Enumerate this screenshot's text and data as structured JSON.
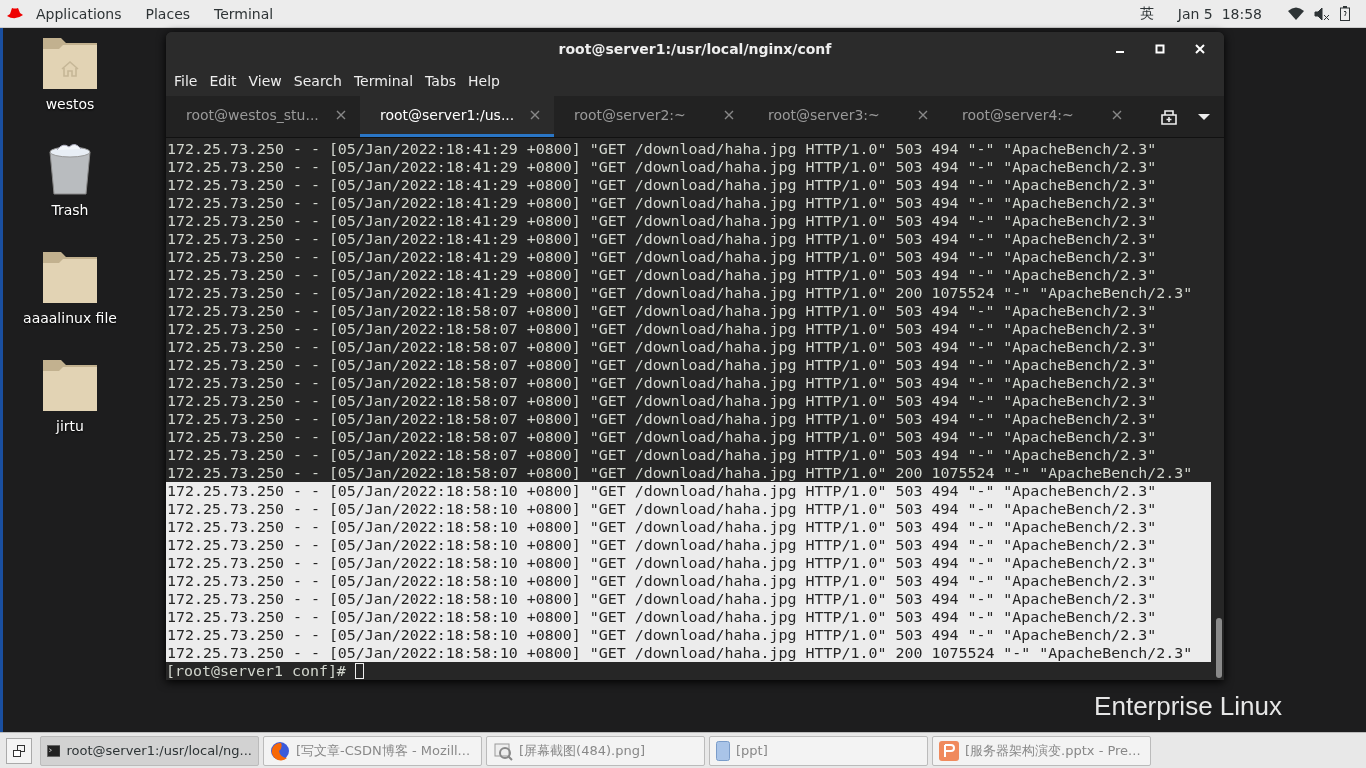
{
  "top_bar": {
    "menus": [
      "Applications",
      "Places",
      "Terminal"
    ],
    "input_method": "英",
    "clock": "Jan 5  18:58"
  },
  "desktop_icons": [
    {
      "label": "westos",
      "kind": "home"
    },
    {
      "label": "Trash",
      "kind": "trash"
    },
    {
      "label": "aaaalinux file",
      "kind": "folder"
    },
    {
      "label": "jirtu",
      "kind": "folder"
    }
  ],
  "wallpaper_text": "Enterprise Linux",
  "terminal": {
    "title": "root@server1:/usr/local/nginx/conf",
    "menu": [
      "File",
      "Edit",
      "View",
      "Search",
      "Terminal",
      "Tabs",
      "Help"
    ],
    "tabs": [
      {
        "label": "root@westos_stu...",
        "selected": false
      },
      {
        "label": "root@server1:/us...",
        "selected": true
      },
      {
        "label": "root@server2:~",
        "selected": false
      },
      {
        "label": "root@server3:~",
        "selected": false
      },
      {
        "label": "root@server4:~",
        "selected": false
      }
    ],
    "lines": [
      {
        "text": "172.25.73.250 - - [05/Jan/2022:18:41:29 +0800] \"GET /download/haha.jpg HTTP/1.0\" 503 494 \"-\" \"ApacheBench/2.3\"",
        "selected": false
      },
      {
        "text": "172.25.73.250 - - [05/Jan/2022:18:41:29 +0800] \"GET /download/haha.jpg HTTP/1.0\" 503 494 \"-\" \"ApacheBench/2.3\"",
        "selected": false
      },
      {
        "text": "172.25.73.250 - - [05/Jan/2022:18:41:29 +0800] \"GET /download/haha.jpg HTTP/1.0\" 503 494 \"-\" \"ApacheBench/2.3\"",
        "selected": false
      },
      {
        "text": "172.25.73.250 - - [05/Jan/2022:18:41:29 +0800] \"GET /download/haha.jpg HTTP/1.0\" 503 494 \"-\" \"ApacheBench/2.3\"",
        "selected": false
      },
      {
        "text": "172.25.73.250 - - [05/Jan/2022:18:41:29 +0800] \"GET /download/haha.jpg HTTP/1.0\" 503 494 \"-\" \"ApacheBench/2.3\"",
        "selected": false
      },
      {
        "text": "172.25.73.250 - - [05/Jan/2022:18:41:29 +0800] \"GET /download/haha.jpg HTTP/1.0\" 503 494 \"-\" \"ApacheBench/2.3\"",
        "selected": false
      },
      {
        "text": "172.25.73.250 - - [05/Jan/2022:18:41:29 +0800] \"GET /download/haha.jpg HTTP/1.0\" 503 494 \"-\" \"ApacheBench/2.3\"",
        "selected": false
      },
      {
        "text": "172.25.73.250 - - [05/Jan/2022:18:41:29 +0800] \"GET /download/haha.jpg HTTP/1.0\" 503 494 \"-\" \"ApacheBench/2.3\"",
        "selected": false
      },
      {
        "text": "172.25.73.250 - - [05/Jan/2022:18:41:29 +0800] \"GET /download/haha.jpg HTTP/1.0\" 200 1075524 \"-\" \"ApacheBench/2.3\"",
        "selected": false
      },
      {
        "text": "172.25.73.250 - - [05/Jan/2022:18:58:07 +0800] \"GET /download/haha.jpg HTTP/1.0\" 503 494 \"-\" \"ApacheBench/2.3\"",
        "selected": false
      },
      {
        "text": "172.25.73.250 - - [05/Jan/2022:18:58:07 +0800] \"GET /download/haha.jpg HTTP/1.0\" 503 494 \"-\" \"ApacheBench/2.3\"",
        "selected": false
      },
      {
        "text": "172.25.73.250 - - [05/Jan/2022:18:58:07 +0800] \"GET /download/haha.jpg HTTP/1.0\" 503 494 \"-\" \"ApacheBench/2.3\"",
        "selected": false
      },
      {
        "text": "172.25.73.250 - - [05/Jan/2022:18:58:07 +0800] \"GET /download/haha.jpg HTTP/1.0\" 503 494 \"-\" \"ApacheBench/2.3\"",
        "selected": false
      },
      {
        "text": "172.25.73.250 - - [05/Jan/2022:18:58:07 +0800] \"GET /download/haha.jpg HTTP/1.0\" 503 494 \"-\" \"ApacheBench/2.3\"",
        "selected": false
      },
      {
        "text": "172.25.73.250 - - [05/Jan/2022:18:58:07 +0800] \"GET /download/haha.jpg HTTP/1.0\" 503 494 \"-\" \"ApacheBench/2.3\"",
        "selected": false
      },
      {
        "text": "172.25.73.250 - - [05/Jan/2022:18:58:07 +0800] \"GET /download/haha.jpg HTTP/1.0\" 503 494 \"-\" \"ApacheBench/2.3\"",
        "selected": false
      },
      {
        "text": "172.25.73.250 - - [05/Jan/2022:18:58:07 +0800] \"GET /download/haha.jpg HTTP/1.0\" 503 494 \"-\" \"ApacheBench/2.3\"",
        "selected": false
      },
      {
        "text": "172.25.73.250 - - [05/Jan/2022:18:58:07 +0800] \"GET /download/haha.jpg HTTP/1.0\" 503 494 \"-\" \"ApacheBench/2.3\"",
        "selected": false
      },
      {
        "text": "172.25.73.250 - - [05/Jan/2022:18:58:07 +0800] \"GET /download/haha.jpg HTTP/1.0\" 200 1075524 \"-\" \"ApacheBench/2.3\"",
        "selected": false
      },
      {
        "text": "172.25.73.250 - - [05/Jan/2022:18:58:10 +0800] \"GET /download/haha.jpg HTTP/1.0\" 503 494 \"-\" \"ApacheBench/2.3\"",
        "selected": true
      },
      {
        "text": "172.25.73.250 - - [05/Jan/2022:18:58:10 +0800] \"GET /download/haha.jpg HTTP/1.0\" 503 494 \"-\" \"ApacheBench/2.3\"",
        "selected": true
      },
      {
        "text": "172.25.73.250 - - [05/Jan/2022:18:58:10 +0800] \"GET /download/haha.jpg HTTP/1.0\" 503 494 \"-\" \"ApacheBench/2.3\"",
        "selected": true
      },
      {
        "text": "172.25.73.250 - - [05/Jan/2022:18:58:10 +0800] \"GET /download/haha.jpg HTTP/1.0\" 503 494 \"-\" \"ApacheBench/2.3\"",
        "selected": true
      },
      {
        "text": "172.25.73.250 - - [05/Jan/2022:18:58:10 +0800] \"GET /download/haha.jpg HTTP/1.0\" 503 494 \"-\" \"ApacheBench/2.3\"",
        "selected": true
      },
      {
        "text": "172.25.73.250 - - [05/Jan/2022:18:58:10 +0800] \"GET /download/haha.jpg HTTP/1.0\" 503 494 \"-\" \"ApacheBench/2.3\"",
        "selected": true
      },
      {
        "text": "172.25.73.250 - - [05/Jan/2022:18:58:10 +0800] \"GET /download/haha.jpg HTTP/1.0\" 503 494 \"-\" \"ApacheBench/2.3\"",
        "selected": true
      },
      {
        "text": "172.25.73.250 - - [05/Jan/2022:18:58:10 +0800] \"GET /download/haha.jpg HTTP/1.0\" 503 494 \"-\" \"ApacheBench/2.3\"",
        "selected": true
      },
      {
        "text": "172.25.73.250 - - [05/Jan/2022:18:58:10 +0800] \"GET /download/haha.jpg HTTP/1.0\" 503 494 \"-\" \"ApacheBench/2.3\"",
        "selected": true
      },
      {
        "text": "172.25.73.250 - - [05/Jan/2022:18:58:10 +0800] \"GET /download/haha.jpg HTTP/1.0\" 200 1075524 \"-\" \"ApacheBench/2.3\"",
        "selected": true
      }
    ],
    "prompt": "[root@server1 conf]#"
  },
  "taskbar": {
    "items": [
      {
        "label": "root@server1:/usr/local/ng...",
        "kind": "terminal",
        "selected": true
      },
      {
        "label": "[写文章-CSDN博客 - Mozill...",
        "kind": "browser",
        "selected": false
      },
      {
        "label": "[屏幕截图(484).png]",
        "kind": "image",
        "selected": false
      },
      {
        "label": "[ppt]",
        "kind": "document",
        "selected": false
      },
      {
        "label": "[服务器架构演变.pptx - Pre...",
        "kind": "slides",
        "selected": false
      }
    ]
  }
}
